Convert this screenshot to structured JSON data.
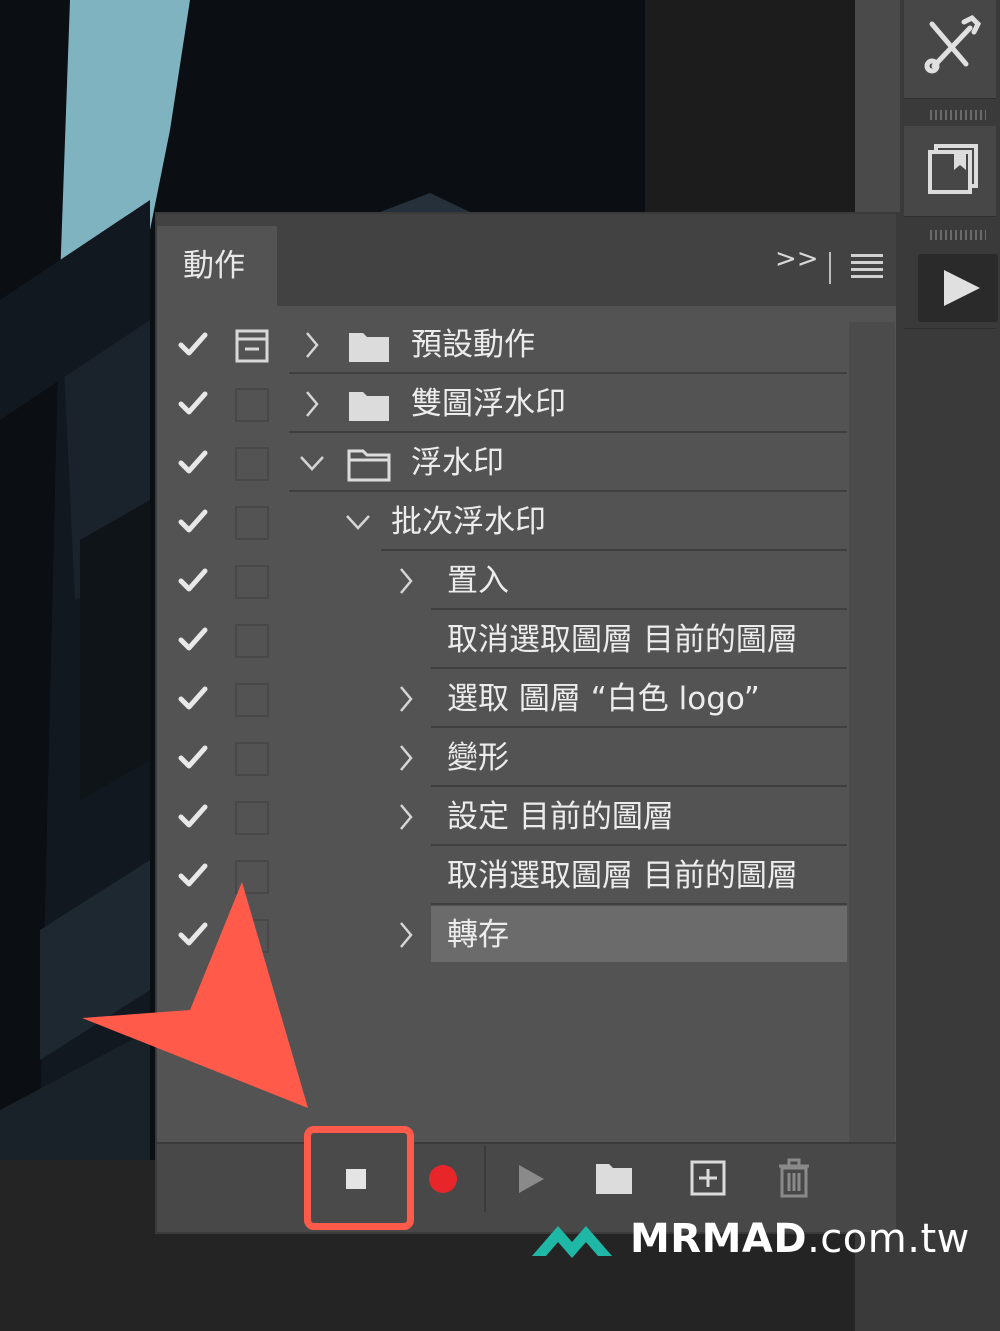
{
  "panel": {
    "tab_title": "動作",
    "collapse_glyph": ">>"
  },
  "rows": [
    {
      "label": "預設動作",
      "check": true,
      "dialog_icon": true,
      "expand": "collapsed",
      "type": "set"
    },
    {
      "label": "雙圖浮水印",
      "check": true,
      "dialog_icon": false,
      "expand": "collapsed",
      "type": "set"
    },
    {
      "label": "浮水印",
      "check": true,
      "dialog_icon": false,
      "expand": "expanded",
      "type": "set"
    },
    {
      "label": "批次浮水印",
      "check": true,
      "dialog_icon": false,
      "expand": "expanded",
      "type": "action"
    },
    {
      "label": "置入",
      "check": true,
      "dialog_icon": false,
      "expand": "collapsed",
      "type": "step"
    },
    {
      "label": "取消選取圖層 目前的圖層",
      "check": true,
      "dialog_icon": false,
      "expand": "none",
      "type": "step"
    },
    {
      "label": "選取 圖層 “白色 logo”",
      "check": true,
      "dialog_icon": false,
      "expand": "collapsed",
      "type": "step"
    },
    {
      "label": "變形",
      "check": true,
      "dialog_icon": false,
      "expand": "collapsed",
      "type": "step"
    },
    {
      "label": "設定 目前的圖層",
      "check": true,
      "dialog_icon": false,
      "expand": "collapsed",
      "type": "step"
    },
    {
      "label": "取消選取圖層 目前的圖層",
      "check": true,
      "dialog_icon": false,
      "expand": "none",
      "type": "step"
    },
    {
      "label": "轉存",
      "check": true,
      "dialog_icon": false,
      "expand": "collapsed",
      "type": "step",
      "selected": true
    }
  ],
  "toolbar": {
    "buttons": [
      "stop-icon",
      "record-icon",
      "play-icon",
      "folder-icon",
      "new-action-icon",
      "trash-icon"
    ],
    "record_color": "#e8262a"
  },
  "annotation": {
    "arrow_color": "#ff5a4a",
    "highlight_target": "stop-button"
  },
  "watermark": {
    "brand": "MRMAD",
    "domain": ".com.tw",
    "logo_color": "#1fb8a6"
  },
  "colors": {
    "panel_bg": "#535353",
    "selected_row": "#6b6b6b",
    "text": "#ececec"
  }
}
